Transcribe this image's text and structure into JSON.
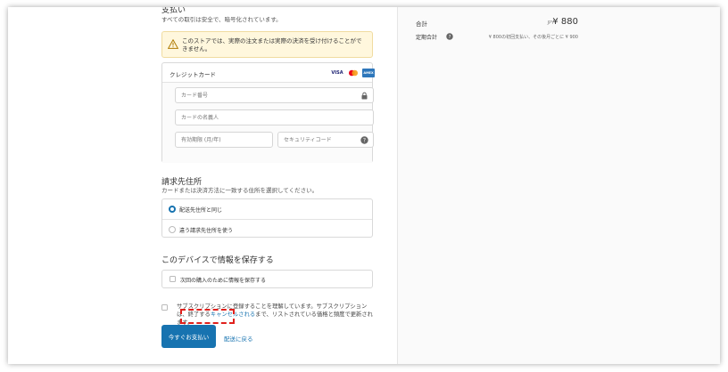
{
  "payment": {
    "title": "支払い",
    "subtitle": "すべての取引は安全で、暗号化されています。",
    "warning": "このストアでは、実際の注文または実際の決済を受け付けることができません。",
    "method_label": "クレジットカード",
    "brands": [
      "VISA",
      "MC",
      "AMEX"
    ],
    "fields": {
      "card_number": "カード番号",
      "card_name": "カードの名義人",
      "expiry": "有効期限 (月/年)",
      "cvv": "セキュリティコード"
    }
  },
  "billing": {
    "title": "請求先住所",
    "subtitle": "カードまたは決済方法に一致する住所を選択してください。",
    "options": [
      "配送先住所と同じ",
      "違う請求先住所を使う"
    ]
  },
  "save_info": {
    "title": "このデバイスで情報を保存する",
    "checkbox": "次回の購入のために情報を保存する"
  },
  "consent": {
    "text_before": "サブスクリプションに登録することを理解しています。サブスクリプションは、終了する",
    "link": "キャンセルされる",
    "text_after": "まで、リストされている価格と頻度で更新されます。"
  },
  "actions": {
    "pay_now": "今すぐお支払い",
    "back": "配送に戻る"
  },
  "summary": {
    "total_label": "合計",
    "currency": "JPY",
    "total_value": "¥ 880",
    "recurring_label": "定期合計",
    "recurring_value": "¥ 800の初回支払い、その後月ごとに ¥ 900"
  },
  "colors": {
    "accent": "#1773b0",
    "warning_bg": "#fff7dd",
    "annotation": "#e0201c"
  }
}
